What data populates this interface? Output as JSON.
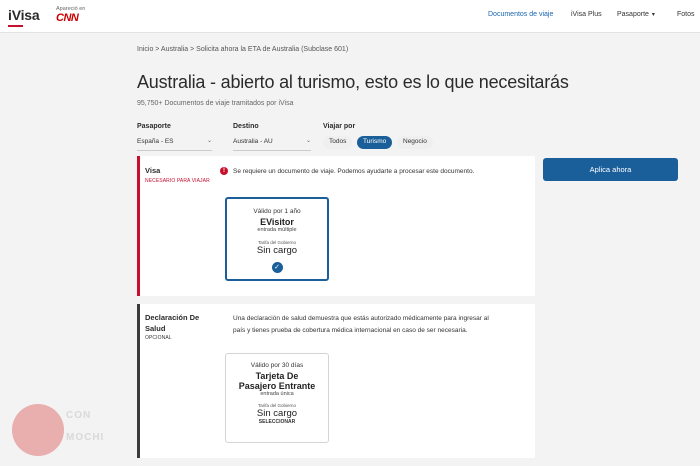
{
  "header": {
    "logo": "iVisa",
    "appeared_label": "Apareció en",
    "cnn": "CNN",
    "nav": [
      {
        "label": "Documentos de viaje",
        "active": true
      },
      {
        "label": "iVisa Plus",
        "active": false
      },
      {
        "label": "Pasaporte",
        "active": false,
        "dropdown": true
      },
      {
        "label": "Fotos",
        "active": false
      }
    ]
  },
  "breadcrumb": "Inicio > Australia > Solicita ahora la ETA de Australia (Subclase 601)",
  "title": "Australia - abierto al turismo, esto es lo que necesitarás",
  "subtitle": "95,750+ Documentos de viaje tramitados por iVisa",
  "filters": {
    "passport": {
      "label": "Pasaporte",
      "value": "España - ES"
    },
    "destination": {
      "label": "Destino",
      "value": "Australia - AU"
    },
    "travel": {
      "label": "Viajar por",
      "options": [
        "Todos",
        "Turismo",
        "Negocio"
      ],
      "selected": "Turismo"
    }
  },
  "apply_button": "Aplica ahora",
  "cards": [
    {
      "name": "Visa",
      "requirement": "NECESARIO PARA VIAJAR",
      "description": "Se requiere un documento de viaje. Podemos ayudarte a procesar este documento.",
      "product": {
        "validity": "Válido por 1 año",
        "name": "EVisitor",
        "entry": "entrada múltiple",
        "tariff_label": "Tarifa del Gobierno",
        "price": "Sin cargo",
        "selected": true
      }
    },
    {
      "name": "Declaración De Salud",
      "requirement": "OPCIONAL",
      "description_lines": [
        "Una declaración de salud demuestra que estás autorizado médicamente para ingresar al",
        "país y tienes prueba de cobertura médica internacional en caso de ser necesaria."
      ],
      "product": {
        "validity": "Válido por 30 días",
        "name_lines": [
          "Tarjeta De",
          "Pasajero Entrante"
        ],
        "entry": "entrada única",
        "tariff_label": "Tarifa del Gobierno",
        "price": "Sin cargo",
        "action": "SELECCIONAR"
      }
    }
  ],
  "watermark": {
    "text_lines": [
      "CON",
      "MOCHI"
    ]
  },
  "colors": {
    "primary": "#1a5f9a",
    "required": "#c8102e",
    "optional_bar": "#3a3a3a",
    "background": "#f3f3f4"
  },
  "icons": {
    "alert": "alert-circle-icon",
    "check": "check-circle-icon",
    "chevron": "chevron-down-icon"
  }
}
